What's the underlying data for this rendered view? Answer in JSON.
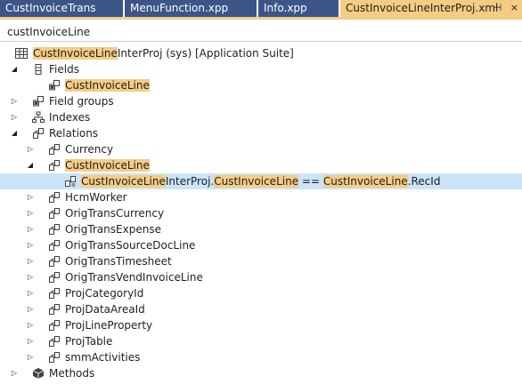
{
  "tabs": [
    {
      "label": "CustInvoiceTrans"
    },
    {
      "label": "MenuFunction.xpp"
    },
    {
      "label": "Info.xpp"
    },
    {
      "label": "CustInvoiceLineInterProj.xml"
    }
  ],
  "tab_actions": {
    "pin": "⊣",
    "close": "×"
  },
  "search": {
    "value": "custInvoiceLine"
  },
  "tree": {
    "root": {
      "highlight": "CustInvoiceLine",
      "rest": "InterProj (sys) [Application Suite]"
    },
    "fields": {
      "label": "Fields",
      "child": "CustInvoiceLine"
    },
    "field_groups": {
      "label": "Field groups"
    },
    "indexes": {
      "label": "Indexes"
    },
    "relations": {
      "label": "Relations"
    },
    "currency": {
      "label": "Currency"
    },
    "custinvoiceline_rel": {
      "label": "CustInvoiceLine"
    },
    "relation_expr": {
      "p1": "CustInvoiceLine",
      "p2": "InterProj.",
      "p3": "CustInvoiceLine",
      "p4": " == ",
      "p5": "CustInvoiceLine",
      "p6": ".RecId"
    },
    "relations_rest": [
      "HcmWorker",
      "OrigTransCurrency",
      "OrigTransExpense",
      "OrigTransSourceDocLine",
      "OrigTransTimesheet",
      "OrigTransVendInvoiceLine",
      "ProjCategoryId",
      "ProjDataAreaId",
      "ProjLineProperty",
      "ProjTable",
      "smmActivities"
    ],
    "methods": {
      "label": "Methods"
    }
  },
  "colors": {
    "tab_bg": "#3b5589",
    "active_tab": "#f5cc84",
    "selection": "#cce4f7",
    "highlight": "#f5cc84"
  }
}
